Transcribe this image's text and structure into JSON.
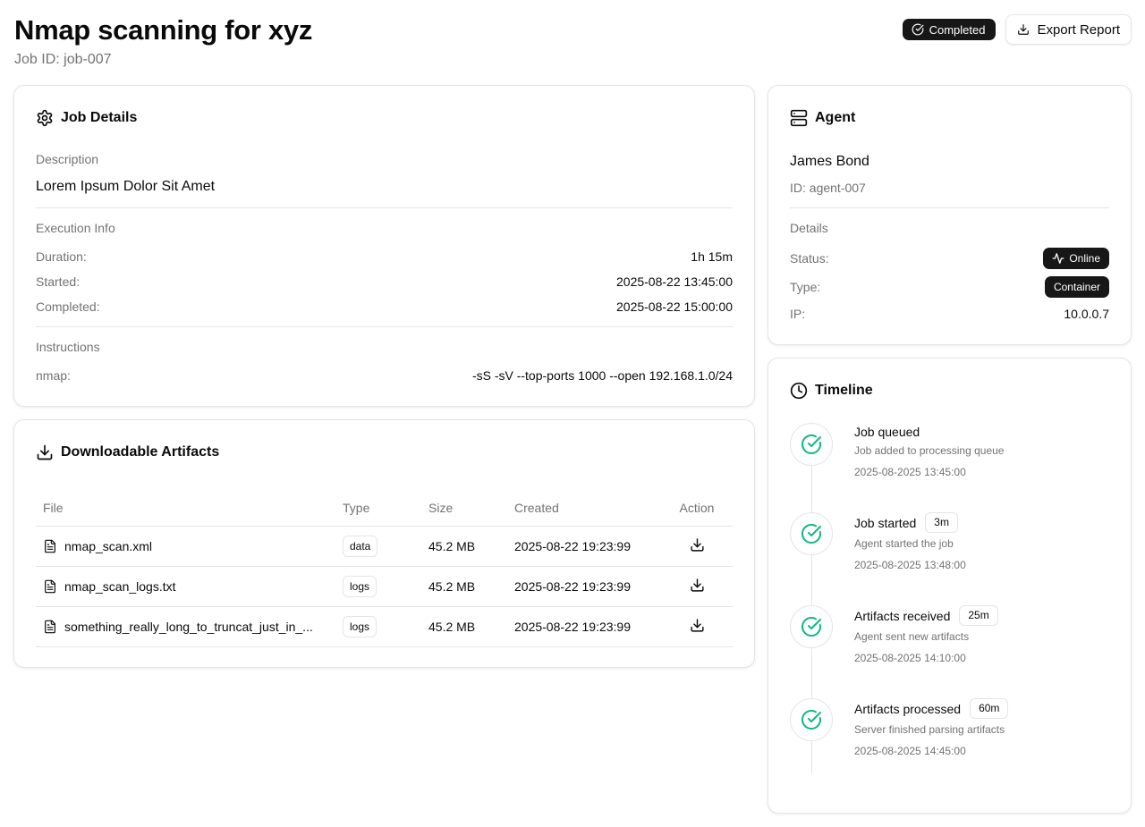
{
  "header": {
    "title": "Nmap scanning for xyz",
    "job_id": "Job ID: job-007",
    "status_badge": "Completed",
    "export_label": "Export Report"
  },
  "job_details": {
    "title": "Job Details",
    "description_label": "Description",
    "description": "Lorem Ipsum Dolor Sit Amet",
    "execution_label": "Execution Info",
    "duration_label": "Duration:",
    "duration": "1h 15m",
    "started_label": "Started:",
    "started": "2025-08-22 13:45:00",
    "completed_label": "Completed:",
    "completed": "2025-08-22 15:00:00",
    "instructions_label": "Instructions",
    "nmap_label": "nmap:",
    "nmap_args": "-sS -sV --top-ports 1000 --open 192.168.1.0/24"
  },
  "artifacts": {
    "title": "Downloadable Artifacts",
    "columns": [
      "File",
      "Type",
      "Size",
      "Created",
      "Action"
    ],
    "rows": [
      {
        "file": "nmap_scan.xml",
        "type": "data",
        "size": "45.2 MB",
        "created": "2025-08-22 19:23:99"
      },
      {
        "file": "nmap_scan_logs.txt",
        "type": "logs",
        "size": "45.2 MB",
        "created": "2025-08-22 19:23:99"
      },
      {
        "file": "something_really_long_to_truncat_just_in_...",
        "type": "logs",
        "size": "45.2 MB",
        "created": "2025-08-22 19:23:99"
      }
    ]
  },
  "agent": {
    "title": "Agent",
    "name": "James Bond",
    "id": "ID: agent-007",
    "details_label": "Details",
    "status_label": "Status:",
    "status": "Online",
    "type_label": "Type:",
    "type": "Container",
    "ip_label": "IP:",
    "ip": "10.0.0.7"
  },
  "timeline": {
    "title": "Timeline",
    "events": [
      {
        "title": "Job queued",
        "duration": "",
        "desc": "Job added to processing queue",
        "time": "2025-08-2025 13:45:00"
      },
      {
        "title": "Job started",
        "duration": "3m",
        "desc": "Agent started the job",
        "time": "2025-08-2025 13:48:00"
      },
      {
        "title": "Artifacts received",
        "duration": "25m",
        "desc": "Agent sent new artifacts",
        "time": "2025-08-2025 14:10:00"
      },
      {
        "title": "Artifacts processed",
        "duration": "60m",
        "desc": "Server finished parsing artifacts",
        "time": "2025-08-2025 14:45:00"
      }
    ]
  },
  "colors": {
    "accent_dark": "#171717",
    "success": "#10b981",
    "muted_text": "#737373",
    "border": "#e5e5e5"
  },
  "icons": [
    "circle-check-icon",
    "download-icon",
    "gear-icon",
    "server-icon",
    "clock-icon",
    "file-icon",
    "activity-icon"
  ]
}
